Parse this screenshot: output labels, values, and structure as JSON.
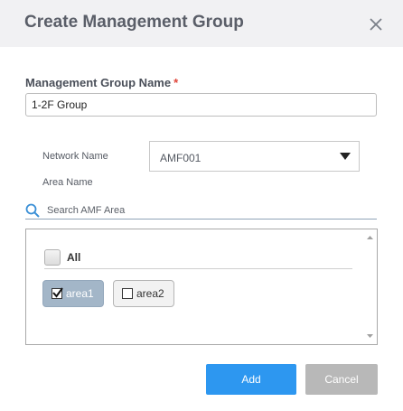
{
  "dialog": {
    "title": "Create Management Group",
    "close_icon": "close-icon"
  },
  "form": {
    "group_name_label": "Management Group Name",
    "required_marker": "*",
    "group_name_value": "1-2F Group",
    "network_name_label": "Network Name",
    "network_name_selected": "AMF001",
    "area_name_label": "Area Name",
    "search_placeholder": "Search AMF Area",
    "search_icon": "search-icon"
  },
  "areas": {
    "all_label": "All",
    "all_checked": false,
    "items": [
      {
        "label": "area1",
        "checked": true
      },
      {
        "label": "area2",
        "checked": false
      }
    ]
  },
  "buttons": {
    "add_label": "Add",
    "cancel_label": "Cancel"
  },
  "colors": {
    "accent": "#2d97f0",
    "cancel": "#b8b8b8",
    "header_bg": "#f1f1f3",
    "selected_chip": "#a3b6c8",
    "required": "#e0463a"
  }
}
